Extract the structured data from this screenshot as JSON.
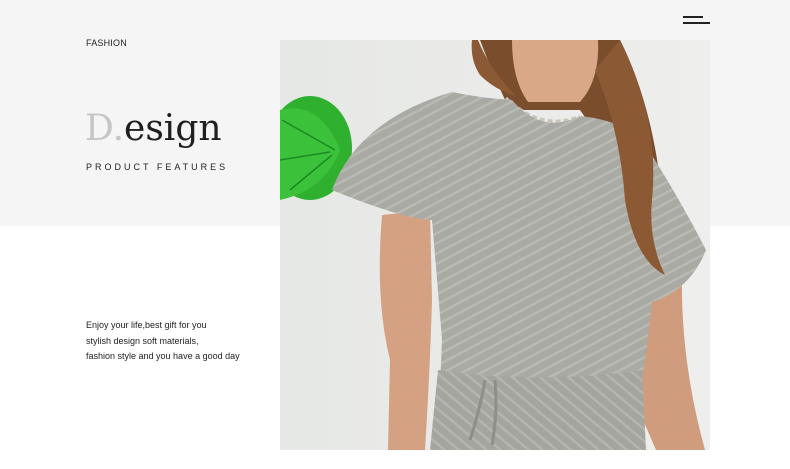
{
  "header": {
    "category": "FASHION"
  },
  "hero": {
    "title_initial": "D.",
    "title_rest": "esign",
    "subtitle": "PRODUCT FEATURES"
  },
  "description": {
    "lines": [
      "Enjoy your life,best gift for you",
      "stylish design soft materials,",
      "fashion style and you have a good day"
    ]
  },
  "icons": {
    "menu": "hamburger-menu-icon"
  },
  "colors": {
    "band_background": "#f5f5f5",
    "page_background": "#ffffff",
    "title_initial": "#c6c6c6",
    "text": "#222222",
    "garment": "#a8a9a2",
    "leaf": "#2fb12f"
  }
}
